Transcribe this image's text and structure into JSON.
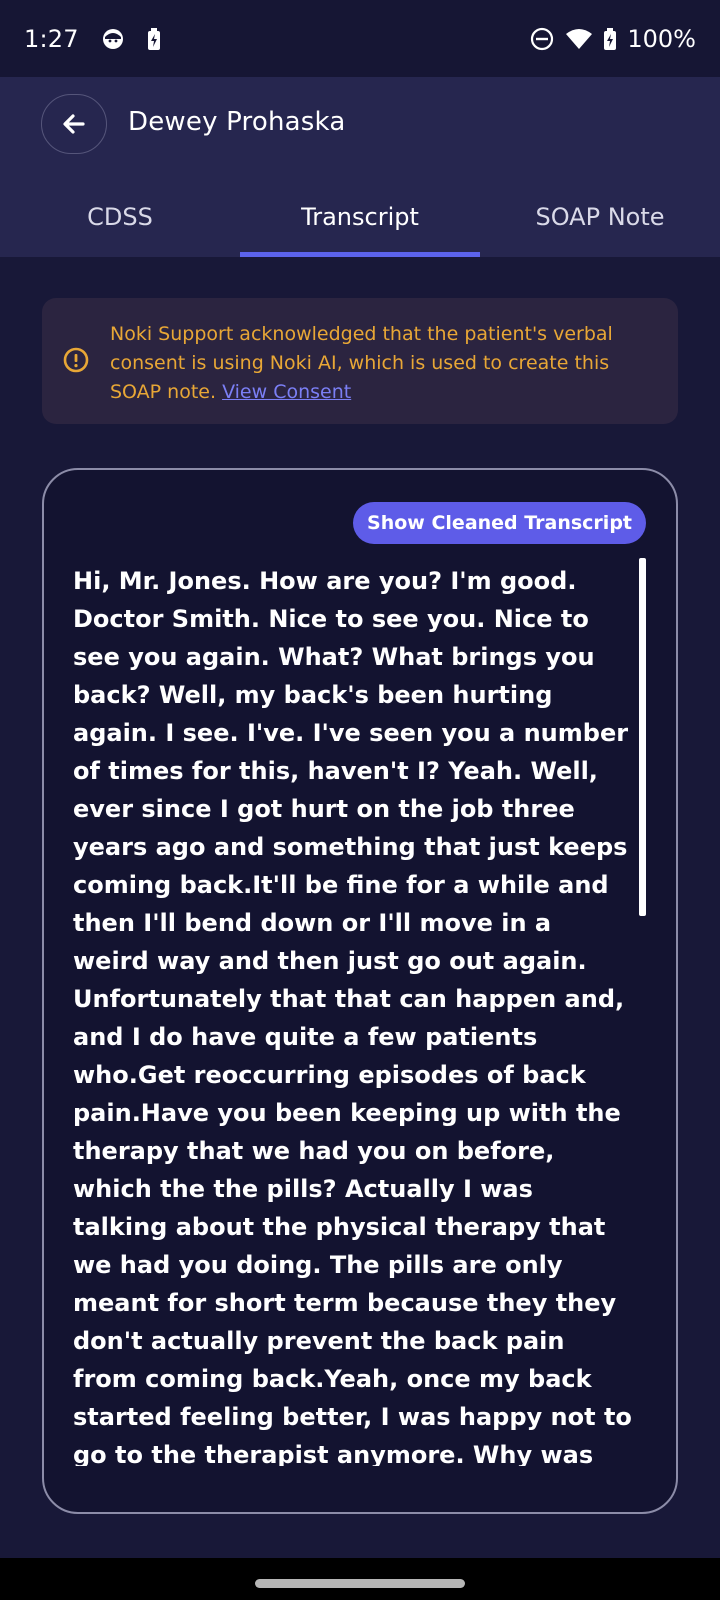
{
  "status_bar": {
    "time": "1:27",
    "battery_text": "100%",
    "icons": [
      "face-icon",
      "battery-saver-icon",
      "dnd-icon",
      "wifi-icon",
      "battery-charging-icon"
    ]
  },
  "header": {
    "patient_name": "Dewey Prohaska",
    "back_icon": "arrow-left-icon"
  },
  "tabs": [
    {
      "label": "CDSS",
      "active": false
    },
    {
      "label": "Transcript",
      "active": true
    },
    {
      "label": "SOAP Note",
      "active": false
    }
  ],
  "consent": {
    "text": "Noki Support acknowledged that the patient's verbal consent is using Noki AI, which is used to create this SOAP note. ",
    "link_label": "View Consent",
    "icon": "info-circle-icon"
  },
  "transcript": {
    "button_label": "Show Cleaned Transcript",
    "text": "Hi, Mr. Jones. How are you? I'm good. Doctor Smith. Nice to see you. Nice to see you again. What? What brings you back? Well, my back's been hurting again. I see. I've. I've seen you a number of times for this, haven't I? Yeah. Well, ever since I got hurt on the job three years ago and something that just keeps coming back.It'll be fine for a while and then I'll bend down or I'll move in a weird way and then just go out again. Unfortunately that that can happen and, and I do have quite a few patients who.Get reoccurring episodes of back pain.Have you been keeping up with the therapy that we had you on before, which the the pills? Actually I was talking about the physical therapy that we had you doing. The pills are only meant for short term because they they don't actually prevent the back pain from coming back.Yeah, once my back started feeling better, I was happy not to go to the therapist anymore. Why was that? What's starting to become kind of a hassle?You know with my work schedule and the cost."
  },
  "colors": {
    "background": "#181838",
    "app_bar": "#26264f",
    "accent": "#5c63ec",
    "warning": "#e8a736",
    "link": "#7b7ff5"
  }
}
